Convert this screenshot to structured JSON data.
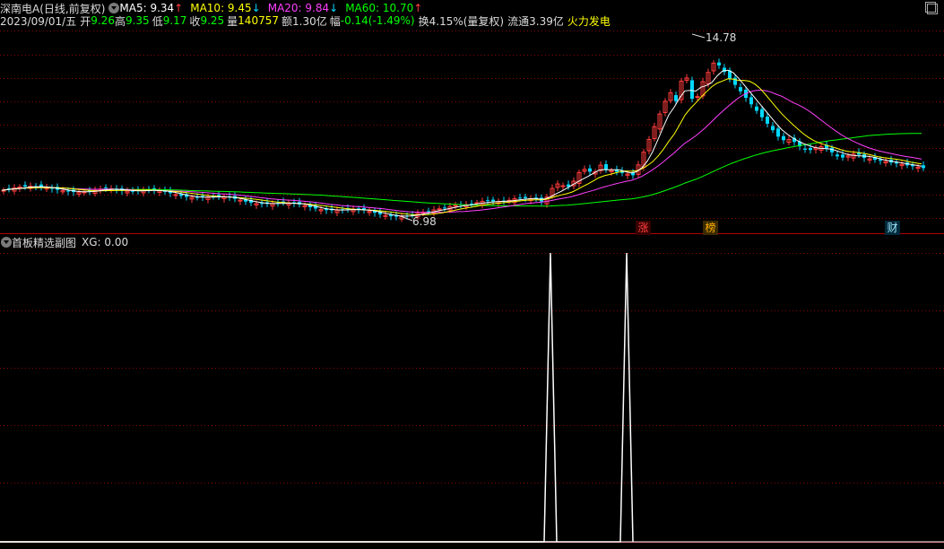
{
  "colors": {
    "up": "#ff3c3c",
    "down": "#00d8ff",
    "ma5": "#ffffff",
    "ma10": "#ffff00",
    "ma20": "#ff40ff",
    "ma60": "#00ff00",
    "grid": "#8b0000",
    "volume": "#ffffff",
    "text_white": "#dcdcdc",
    "text_yellow": "#ffff00"
  },
  "header": {
    "stock_title": "深南电A(日线,前复权)",
    "ma5": "MA5: 9.34",
    "ma10": "MA10: 9.45",
    "ma20": "MA20: 9.84",
    "ma60": "MA60: 10.70",
    "ma5_arrow": "↑",
    "ma10_arrow": "↓",
    "ma20_arrow": "↓",
    "ma60_arrow": "↑"
  },
  "info_line": {
    "date": "2023/09/01/五",
    "open_label": "开",
    "open": "9.26",
    "high_label": "高",
    "high": "9.35",
    "low_label": "低",
    "low": "9.17",
    "close_label": "收",
    "close": "9.25",
    "vol_label": "量",
    "vol": "140757",
    "amount_label": "额",
    "amount": "1.30亿",
    "change_label": "幅",
    "change": "-0.14(-1.49%)",
    "turnover": "换4.15%(量复权)",
    "float": "流通3.39亿",
    "concept": "火力发电"
  },
  "annotations": {
    "max_label": "14.78",
    "min_label": "6.98"
  },
  "badges": {
    "zhang": "涨",
    "bang": "榜",
    "cai": "财"
  },
  "sub_panel": {
    "title": "首板精选副图",
    "xg": "XG: 0.00"
  },
  "chart_data": {
    "type": "candlestick",
    "price_range": [
      6.98,
      14.78
    ],
    "indicator": {
      "name": "XG",
      "value": 0.0,
      "spikes": [
        1,
        1
      ]
    }
  }
}
